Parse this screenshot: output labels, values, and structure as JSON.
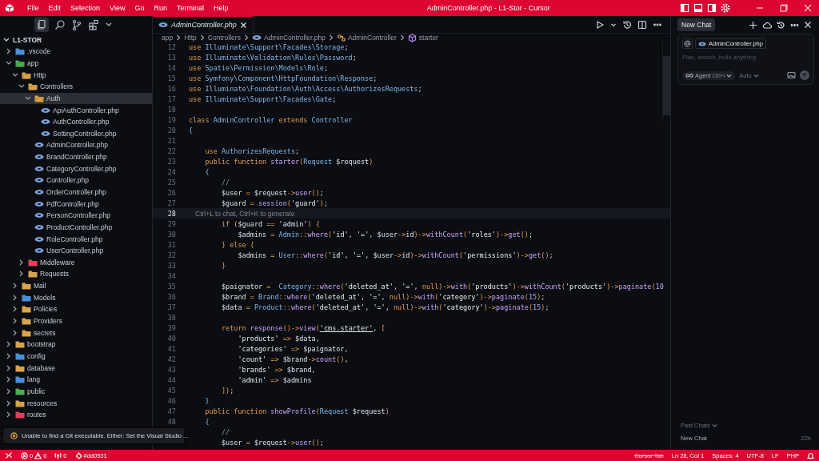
{
  "title_bar": {
    "menu": [
      "File",
      "Edit",
      "Selection",
      "View",
      "Go",
      "Run",
      "Terminal",
      "Help"
    ],
    "title": "AdminController.php - L1-Stor - Cursor"
  },
  "sidebar": {
    "root": "L1-STOR",
    "tree": [
      {
        "name": ".vscode",
        "kind": "folder",
        "expanded": false,
        "selected": false,
        "color": "#4a8fd8"
      },
      {
        "name": "app",
        "kind": "folder",
        "expanded": true,
        "selected": false,
        "color": "#4caf50",
        "children": [
          {
            "name": "Http",
            "kind": "folder",
            "expanded": true,
            "selected": false,
            "color": "#d9a34a",
            "children": [
              {
                "name": "Controllers",
                "kind": "folder",
                "expanded": true,
                "selected": false,
                "color": "#d9a34a",
                "children": [
                  {
                    "name": "Auth",
                    "kind": "folder",
                    "expanded": true,
                    "selected": true,
                    "color": "#d9a34a",
                    "children": [
                      {
                        "name": "ApiAuthController.php",
                        "kind": "file",
                        "selected": false
                      },
                      {
                        "name": "AuthController.php",
                        "kind": "file",
                        "selected": false
                      },
                      {
                        "name": "SettingController.php",
                        "kind": "file",
                        "selected": false
                      }
                    ]
                  },
                  {
                    "name": "AdminController.php",
                    "kind": "file",
                    "selected": false
                  },
                  {
                    "name": "BrandController.php",
                    "kind": "file",
                    "selected": false
                  },
                  {
                    "name": "CategoryController.php",
                    "kind": "file",
                    "selected": false
                  },
                  {
                    "name": "Controller.php",
                    "kind": "file",
                    "selected": false
                  },
                  {
                    "name": "OrderController.php",
                    "kind": "file",
                    "selected": false
                  },
                  {
                    "name": "PdfController.php",
                    "kind": "file",
                    "selected": false
                  },
                  {
                    "name": "PersonController.php",
                    "kind": "file",
                    "selected": false
                  },
                  {
                    "name": "ProductController.php",
                    "kind": "file",
                    "selected": false
                  },
                  {
                    "name": "RoleController.php",
                    "kind": "file",
                    "selected": false
                  },
                  {
                    "name": "UserController.php",
                    "kind": "file",
                    "selected": false
                  }
                ]
              },
              {
                "name": "Middleware",
                "kind": "folder",
                "expanded": false,
                "selected": false,
                "color": "#e0405a"
              },
              {
                "name": "Requests",
                "kind": "folder",
                "expanded": false,
                "selected": false,
                "color": "#d9a34a"
              }
            ]
          },
          {
            "name": "Mail",
            "kind": "folder",
            "expanded": false,
            "selected": false,
            "color": "#d9a34a"
          },
          {
            "name": "Models",
            "kind": "folder",
            "expanded": false,
            "selected": false,
            "color": "#4a8fd8"
          },
          {
            "name": "Policies",
            "kind": "folder",
            "expanded": false,
            "selected": false,
            "color": "#d9a34a"
          },
          {
            "name": "Providers",
            "kind": "folder",
            "expanded": false,
            "selected": false,
            "color": "#d9a34a"
          },
          {
            "name": "secrets",
            "kind": "folder",
            "expanded": false,
            "selected": false,
            "color": "#d9a34a"
          }
        ]
      },
      {
        "name": "bootstrap",
        "kind": "folder",
        "expanded": false,
        "selected": false,
        "color": "#d9a34a"
      },
      {
        "name": "config",
        "kind": "folder",
        "expanded": false,
        "selected": false,
        "color": "#4a8fd8"
      },
      {
        "name": "database",
        "kind": "folder",
        "expanded": false,
        "selected": false,
        "color": "#d9a34a"
      },
      {
        "name": "lang",
        "kind": "folder",
        "expanded": false,
        "selected": false,
        "color": "#4a8fd8"
      },
      {
        "name": "public",
        "kind": "folder",
        "expanded": false,
        "selected": false,
        "color": "#4caf50"
      },
      {
        "name": "resources",
        "kind": "folder",
        "expanded": false,
        "selected": false,
        "color": "#d9a34a"
      },
      {
        "name": "routes",
        "kind": "folder",
        "expanded": false,
        "selected": false,
        "color": "#e0405a"
      }
    ]
  },
  "tabs": [
    {
      "label": "AdminController.php",
      "selected": true
    }
  ],
  "breadcrumbs": [
    {
      "label": "app",
      "kind": "folder"
    },
    {
      "label": "Http",
      "kind": "folder"
    },
    {
      "label": "Controllers",
      "kind": "folder"
    },
    {
      "label": "AdminController.php",
      "kind": "file"
    },
    {
      "label": "AdminController",
      "kind": "class"
    },
    {
      "label": "starter",
      "kind": "method"
    }
  ],
  "code": [
    {
      "n": "12",
      "tokens": [
        {
          "kind": "k",
          "text": "use "
        },
        {
          "kind": "c",
          "text": "Illuminate\\Support\\Facades\\Storage"
        },
        {
          "kind": "p",
          "text": ";"
        }
      ]
    },
    {
      "n": "13",
      "tokens": [
        {
          "kind": "k",
          "text": "use "
        },
        {
          "kind": "c",
          "text": "Illuminate\\Validation\\Rules\\Password"
        },
        {
          "kind": "p",
          "text": ";"
        }
      ]
    },
    {
      "n": "14",
      "tokens": [
        {
          "kind": "k",
          "text": "use "
        },
        {
          "kind": "c",
          "text": "Spatie\\Permission\\Models\\Role"
        },
        {
          "kind": "p",
          "text": ";"
        }
      ]
    },
    {
      "n": "15",
      "tokens": [
        {
          "kind": "k",
          "text": "use "
        },
        {
          "kind": "c",
          "text": "Symfony\\Component\\HttpFoundation\\Response"
        },
        {
          "kind": "p",
          "text": ";"
        }
      ]
    },
    {
      "n": "16",
      "tokens": [
        {
          "kind": "k",
          "text": "use "
        },
        {
          "kind": "c",
          "text": "Illuminate\\Foundation\\Auth\\Access\\AuthorizesRequests"
        },
        {
          "kind": "p",
          "text": ";"
        }
      ]
    },
    {
      "n": "17",
      "tokens": [
        {
          "kind": "k",
          "text": "use "
        },
        {
          "kind": "c",
          "text": "Illuminate\\Support\\Facades\\Gate"
        },
        {
          "kind": "p",
          "text": ";"
        }
      ]
    },
    {
      "n": "18"
    },
    {
      "n": "19",
      "tokens": [
        {
          "kind": "k",
          "text": "class "
        },
        {
          "kind": "c",
          "text": "AdminController "
        },
        {
          "kind": "k",
          "text": "extends "
        },
        {
          "kind": "c",
          "text": "Controller"
        }
      ]
    },
    {
      "n": "20",
      "tokens": [
        {
          "kind": "c",
          "text": "{"
        }
      ]
    },
    {
      "n": "21"
    },
    {
      "n": "22",
      "tokens": [
        {
          "kind": "k",
          "text": "    use "
        },
        {
          "kind": "c",
          "text": "AuthorizesRequests"
        },
        {
          "kind": "p",
          "text": ";"
        }
      ]
    },
    {
      "n": "23",
      "tokens": [
        {
          "kind": "k",
          "text": "    public function "
        },
        {
          "kind": "f",
          "text": "starter"
        },
        {
          "kind": "o",
          "text": "("
        },
        {
          "kind": "c",
          "text": "Request "
        },
        {
          "kind": "v",
          "text": "$request"
        },
        {
          "kind": "o",
          "text": ")"
        }
      ]
    },
    {
      "n": "24",
      "tokens": [
        {
          "kind": "c",
          "text": "    {"
        }
      ]
    },
    {
      "n": "25",
      "tokens": [
        {
          "kind": "m",
          "text": "        //"
        }
      ]
    },
    {
      "n": "26",
      "tokens": [
        {
          "kind": "v",
          "text": "        $user "
        },
        {
          "kind": "o",
          "text": "= "
        },
        {
          "kind": "v",
          "text": "$request"
        },
        {
          "kind": "o",
          "text": "->"
        },
        {
          "kind": "f",
          "text": "user"
        },
        {
          "kind": "o",
          "text": "()"
        },
        {
          "kind": "p",
          "text": ";"
        }
      ]
    },
    {
      "n": "27",
      "tokens": [
        {
          "kind": "v",
          "text": "        $guard "
        },
        {
          "kind": "o",
          "text": "= "
        },
        {
          "kind": "f",
          "text": "session"
        },
        {
          "kind": "o",
          "text": "("
        },
        {
          "kind": "s",
          "text": "'guard'"
        },
        {
          "kind": "o",
          "text": ")"
        },
        {
          "kind": "p",
          "text": ";"
        }
      ]
    },
    {
      "n": "28",
      "current": true,
      "hint": "Ctrl+L to chat, Ctrl+K to generate"
    },
    {
      "n": "29",
      "tokens": [
        {
          "kind": "k",
          "text": "        if "
        },
        {
          "kind": "o",
          "text": "("
        },
        {
          "kind": "v",
          "text": "$guard "
        },
        {
          "kind": "o",
          "text": "== "
        },
        {
          "kind": "s",
          "text": "'admin'"
        },
        {
          "kind": "o",
          "text": ") {"
        }
      ]
    },
    {
      "n": "30",
      "tokens": [
        {
          "kind": "v",
          "text": "            $admins "
        },
        {
          "kind": "o",
          "text": "= "
        },
        {
          "kind": "c",
          "text": "Admin"
        },
        {
          "kind": "o",
          "text": "::"
        },
        {
          "kind": "f",
          "text": "where"
        },
        {
          "kind": "o",
          "text": "("
        },
        {
          "kind": "s",
          "text": "'id'"
        },
        {
          "kind": "p",
          "text": ", "
        },
        {
          "kind": "s",
          "text": "'='"
        },
        {
          "kind": "p",
          "text": ", "
        },
        {
          "kind": "v",
          "text": "$user"
        },
        {
          "kind": "o",
          "text": "->"
        },
        {
          "kind": "v",
          "text": "id"
        },
        {
          "kind": "o",
          "text": ")->"
        },
        {
          "kind": "f",
          "text": "withCount"
        },
        {
          "kind": "o",
          "text": "("
        },
        {
          "kind": "s",
          "text": "'roles'"
        },
        {
          "kind": "o",
          "text": ")->"
        },
        {
          "kind": "f",
          "text": "get"
        },
        {
          "kind": "o",
          "text": "()"
        },
        {
          "kind": "p",
          "text": ";"
        }
      ]
    },
    {
      "n": "31",
      "tokens": [
        {
          "kind": "o",
          "text": "        } "
        },
        {
          "kind": "k",
          "text": "else "
        },
        {
          "kind": "o",
          "text": "{"
        }
      ]
    },
    {
      "n": "32",
      "tokens": [
        {
          "kind": "v",
          "text": "            $admins "
        },
        {
          "kind": "o",
          "text": "= "
        },
        {
          "kind": "c",
          "text": "User"
        },
        {
          "kind": "o",
          "text": "::"
        },
        {
          "kind": "f",
          "text": "where"
        },
        {
          "kind": "o",
          "text": "("
        },
        {
          "kind": "s",
          "text": "'id'"
        },
        {
          "kind": "p",
          "text": ", "
        },
        {
          "kind": "s",
          "text": "'='"
        },
        {
          "kind": "p",
          "text": ", "
        },
        {
          "kind": "v",
          "text": "$user"
        },
        {
          "kind": "o",
          "text": "->"
        },
        {
          "kind": "v",
          "text": "id"
        },
        {
          "kind": "o",
          "text": ")->"
        },
        {
          "kind": "f",
          "text": "withCount"
        },
        {
          "kind": "o",
          "text": "("
        },
        {
          "kind": "s",
          "text": "'permissions'"
        },
        {
          "kind": "o",
          "text": ")->"
        },
        {
          "kind": "f",
          "text": "get"
        },
        {
          "kind": "o",
          "text": "()"
        },
        {
          "kind": "p",
          "text": ";"
        }
      ]
    },
    {
      "n": "33",
      "tokens": [
        {
          "kind": "o",
          "text": "        }"
        }
      ]
    },
    {
      "n": "34"
    },
    {
      "n": "35",
      "tokens": [
        {
          "kind": "v",
          "text": "        $paignator "
        },
        {
          "kind": "o",
          "text": "=  "
        },
        {
          "kind": "c",
          "text": "Category"
        },
        {
          "kind": "o",
          "text": "::"
        },
        {
          "kind": "f",
          "text": "where"
        },
        {
          "kind": "o",
          "text": "("
        },
        {
          "kind": "s",
          "text": "'deleted_at'"
        },
        {
          "kind": "p",
          "text": ", "
        },
        {
          "kind": "s",
          "text": "'='"
        },
        {
          "kind": "p",
          "text": ", "
        },
        {
          "kind": "k",
          "text": "null"
        },
        {
          "kind": "o",
          "text": ")->"
        },
        {
          "kind": "f",
          "text": "with"
        },
        {
          "kind": "o",
          "text": "("
        },
        {
          "kind": "s",
          "text": "'products'"
        },
        {
          "kind": "o",
          "text": ")->"
        },
        {
          "kind": "f",
          "text": "withCount"
        },
        {
          "kind": "o",
          "text": "("
        },
        {
          "kind": "s",
          "text": "'products'"
        },
        {
          "kind": "o",
          "text": ")->"
        },
        {
          "kind": "f",
          "text": "paginate"
        },
        {
          "kind": "o",
          "text": "("
        },
        {
          "kind": "n",
          "text": "10"
        }
      ]
    },
    {
      "n": "36",
      "tokens": [
        {
          "kind": "v",
          "text": "        $brand "
        },
        {
          "kind": "o",
          "text": "= "
        },
        {
          "kind": "c",
          "text": "Brand"
        },
        {
          "kind": "o",
          "text": "::"
        },
        {
          "kind": "f",
          "text": "where"
        },
        {
          "kind": "o",
          "text": "("
        },
        {
          "kind": "s",
          "text": "'deleted_at'"
        },
        {
          "kind": "p",
          "text": ", "
        },
        {
          "kind": "s",
          "text": "'='"
        },
        {
          "kind": "p",
          "text": ", "
        },
        {
          "kind": "k",
          "text": "null"
        },
        {
          "kind": "o",
          "text": ")->"
        },
        {
          "kind": "f",
          "text": "with"
        },
        {
          "kind": "o",
          "text": "("
        },
        {
          "kind": "s",
          "text": "'category'"
        },
        {
          "kind": "o",
          "text": ")->"
        },
        {
          "kind": "f",
          "text": "paginate"
        },
        {
          "kind": "o",
          "text": "("
        },
        {
          "kind": "n",
          "text": "15"
        },
        {
          "kind": "o",
          "text": ")"
        },
        {
          "kind": "p",
          "text": ";"
        }
      ]
    },
    {
      "n": "37",
      "tokens": [
        {
          "kind": "v",
          "text": "        $data "
        },
        {
          "kind": "o",
          "text": "= "
        },
        {
          "kind": "c",
          "text": "Product"
        },
        {
          "kind": "o",
          "text": "::"
        },
        {
          "kind": "f",
          "text": "where"
        },
        {
          "kind": "o",
          "text": "("
        },
        {
          "kind": "s",
          "text": "'deleted_at'"
        },
        {
          "kind": "p",
          "text": ", "
        },
        {
          "kind": "s",
          "text": "'='"
        },
        {
          "kind": "p",
          "text": ", "
        },
        {
          "kind": "k",
          "text": "null"
        },
        {
          "kind": "o",
          "text": ")->"
        },
        {
          "kind": "f",
          "text": "with"
        },
        {
          "kind": "o",
          "text": "("
        },
        {
          "kind": "s",
          "text": "'category'"
        },
        {
          "kind": "o",
          "text": ")->"
        },
        {
          "kind": "f",
          "text": "paginate"
        },
        {
          "kind": "o",
          "text": "("
        },
        {
          "kind": "n",
          "text": "15"
        },
        {
          "kind": "o",
          "text": ")"
        },
        {
          "kind": "p",
          "text": ";"
        }
      ]
    },
    {
      "n": "38"
    },
    {
      "n": "39",
      "tokens": [
        {
          "kind": "k",
          "text": "        return "
        },
        {
          "kind": "f",
          "text": "response"
        },
        {
          "kind": "o",
          "text": "()->"
        },
        {
          "kind": "f",
          "text": "view"
        },
        {
          "kind": "o",
          "text": "("
        },
        {
          "kind": "u",
          "text": "'cms.starter'"
        },
        {
          "kind": "p",
          "text": ", "
        },
        {
          "kind": "o",
          "text": "["
        }
      ]
    },
    {
      "n": "40",
      "tokens": [
        {
          "kind": "s",
          "text": "            'products' "
        },
        {
          "kind": "o",
          "text": "=> "
        },
        {
          "kind": "v",
          "text": "$data"
        },
        {
          "kind": "p",
          "text": ","
        }
      ]
    },
    {
      "n": "41",
      "tokens": [
        {
          "kind": "s",
          "text": "            'categories' "
        },
        {
          "kind": "o",
          "text": "=> "
        },
        {
          "kind": "v",
          "text": "$paignator"
        },
        {
          "kind": "p",
          "text": ","
        }
      ]
    },
    {
      "n": "42",
      "tokens": [
        {
          "kind": "s",
          "text": "            'count' "
        },
        {
          "kind": "o",
          "text": "=> "
        },
        {
          "kind": "v",
          "text": "$brand"
        },
        {
          "kind": "o",
          "text": "->"
        },
        {
          "kind": "f",
          "text": "count"
        },
        {
          "kind": "o",
          "text": "()"
        },
        {
          "kind": "p",
          "text": ","
        }
      ]
    },
    {
      "n": "43",
      "tokens": [
        {
          "kind": "s",
          "text": "            'brands' "
        },
        {
          "kind": "o",
          "text": "=> "
        },
        {
          "kind": "v",
          "text": "$brand"
        },
        {
          "kind": "p",
          "text": ","
        }
      ]
    },
    {
      "n": "44",
      "tokens": [
        {
          "kind": "s",
          "text": "            'admin' "
        },
        {
          "kind": "o",
          "text": "=> "
        },
        {
          "kind": "v",
          "text": "$admins"
        }
      ]
    },
    {
      "n": "45",
      "tokens": [
        {
          "kind": "o",
          "text": "        ])"
        },
        {
          "kind": "p",
          "text": ";"
        }
      ]
    },
    {
      "n": "46",
      "tokens": [
        {
          "kind": "c",
          "text": "    }"
        }
      ]
    },
    {
      "n": "47",
      "tokens": [
        {
          "kind": "k",
          "text": "    public function "
        },
        {
          "kind": "f",
          "text": "showProfile"
        },
        {
          "kind": "o",
          "text": "("
        },
        {
          "kind": "c",
          "text": "Request "
        },
        {
          "kind": "v",
          "text": "$request"
        },
        {
          "kind": "o",
          "text": ")"
        }
      ]
    },
    {
      "n": "48",
      "tokens": [
        {
          "kind": "c",
          "text": "    {"
        }
      ]
    },
    {
      "tokens": [
        {
          "kind": "m",
          "text": "        //"
        }
      ]
    },
    {
      "tokens": [
        {
          "kind": "v",
          "text": "        $user "
        },
        {
          "kind": "o",
          "text": "= "
        },
        {
          "kind": "v",
          "text": "$request"
        },
        {
          "kind": "o",
          "text": "->"
        },
        {
          "kind": "f",
          "text": "user"
        },
        {
          "kind": "o",
          "text": "()"
        },
        {
          "kind": "p",
          "text": ";"
        }
      ]
    }
  ],
  "toast": {
    "message": "Unable to find a Git executable. Either: Set the Visual Studio ..."
  },
  "chat": {
    "new_chat_button": "New Chat",
    "context_chip": "AdminController.php",
    "placeholder": "Plan, search, build anything",
    "mode": "Agent",
    "mode_shortcut": "Ctrl+I",
    "model": "Auto",
    "past_chats_label": "Past Chats",
    "past_chats": [
      {
        "title": "New Chat",
        "time": "22h"
      }
    ]
  },
  "status_bar": {
    "errors": "0",
    "warnings": "0",
    "ports": "0",
    "branch": "#dd0531",
    "cursor_tab": "Cursor Tab",
    "position": "Ln 28, Col 1",
    "spaces": "Spaces: 4",
    "encoding": "UTF-8",
    "eol": "LF",
    "language": "PHP"
  }
}
